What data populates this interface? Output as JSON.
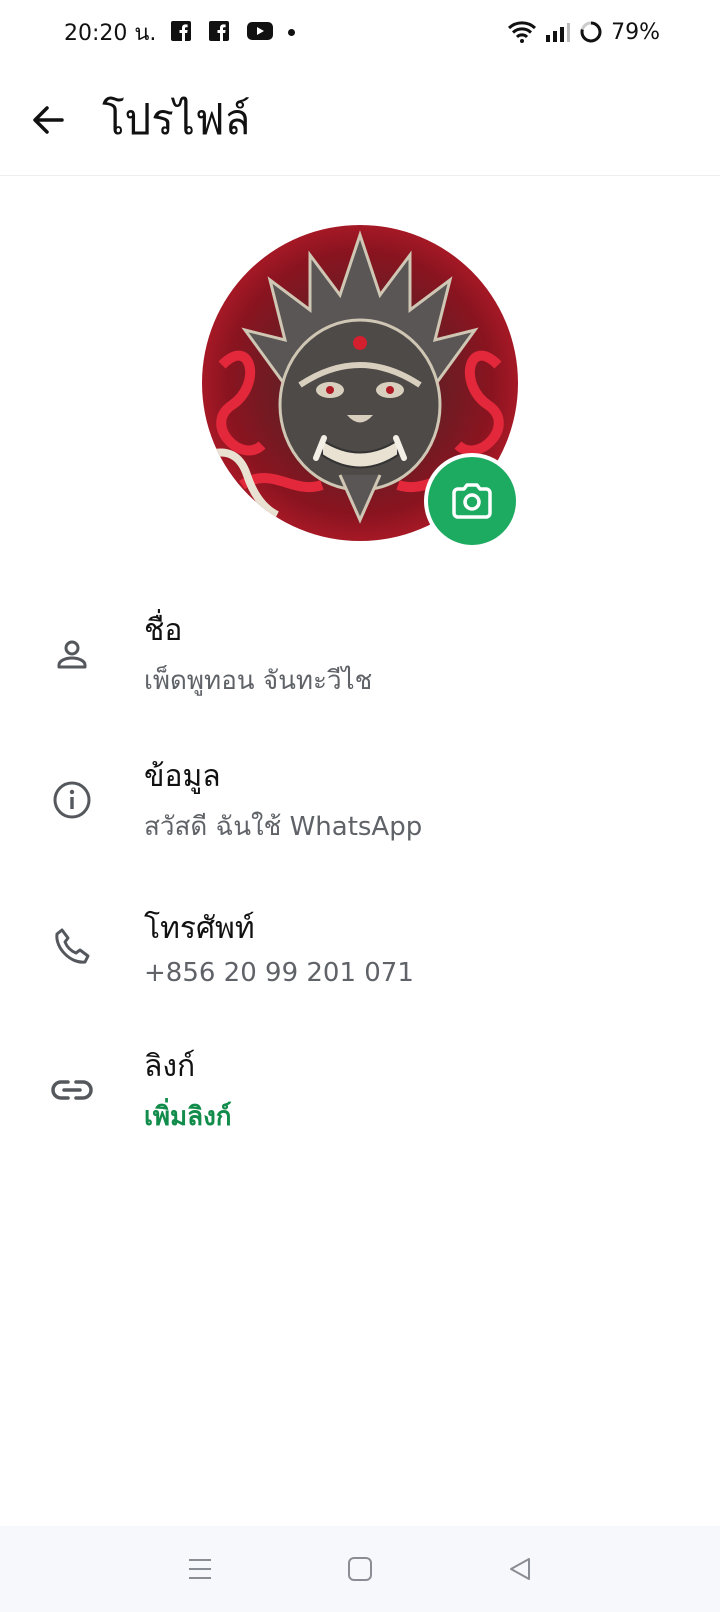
{
  "status_bar": {
    "time": "20:20 น.",
    "battery": "79%"
  },
  "app_bar": {
    "title": "โปรไฟล์"
  },
  "profile": {
    "rows": [
      {
        "label": "ชื่อ",
        "value": "เพ็ดพูทอน จันทะวีไช"
      },
      {
        "label": "ข้อมูล",
        "value": "สวัสดี ฉันใช้ WhatsApp"
      },
      {
        "label": "โทรศัพท์",
        "value": "+856 20 99 201 071"
      },
      {
        "label": "ลิงก์",
        "value": "เพิ่มลิงก์"
      }
    ]
  },
  "colors": {
    "accent": "#1daa61",
    "link": "#128c4a"
  },
  "icons": {
    "back": "arrow-left-icon",
    "camera": "camera-icon",
    "name": "person-icon",
    "about": "info-icon",
    "phone": "phone-icon",
    "link": "link-icon"
  }
}
